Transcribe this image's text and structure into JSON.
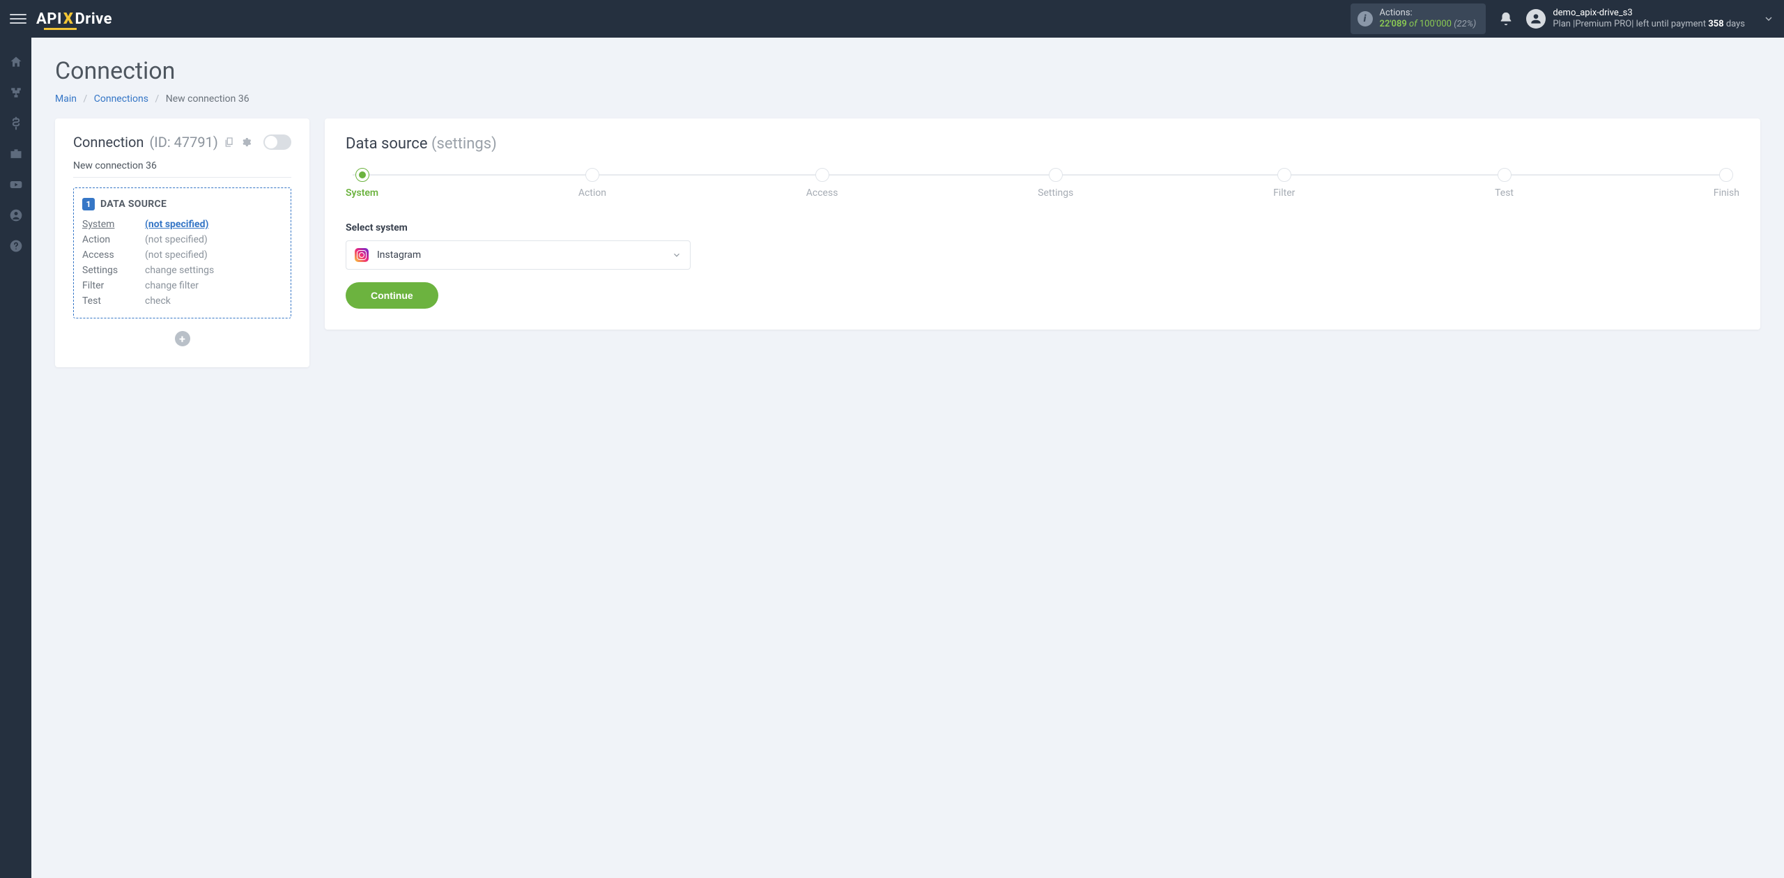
{
  "header": {
    "logo_pre": "API",
    "logo_x": "X",
    "logo_post": "Drive",
    "actions_label": "Actions:",
    "actions_used": "22'089",
    "actions_of": "of",
    "actions_total": "100'000",
    "actions_pct": "(22%)",
    "user_name": "demo_apix-drive_s3",
    "plan_prefix": "Plan |Premium PRO| left until payment ",
    "plan_days": "358",
    "plan_suffix": " days"
  },
  "page": {
    "title": "Connection",
    "crumb_main": "Main",
    "crumb_connections": "Connections",
    "crumb_current": "New connection 36"
  },
  "left": {
    "heading": "Connection",
    "id_label": "(ID: 47791)",
    "name": "New connection 36",
    "box_num": "1",
    "box_title": "DATA SOURCE",
    "rows": [
      {
        "label": "System",
        "value": "(not specified)",
        "label_uline": true,
        "value_link": true
      },
      {
        "label": "Action",
        "value": "(not specified)"
      },
      {
        "label": "Access",
        "value": "(not specified)"
      },
      {
        "label": "Settings",
        "value": "change settings"
      },
      {
        "label": "Filter",
        "value": "change filter"
      },
      {
        "label": "Test",
        "value": "check"
      }
    ]
  },
  "right": {
    "title": "Data source",
    "title_sub": "(settings)",
    "steps": [
      "System",
      "Action",
      "Access",
      "Settings",
      "Filter",
      "Test",
      "Finish"
    ],
    "field_label": "Select system",
    "selected": "Instagram",
    "continue": "Continue"
  }
}
